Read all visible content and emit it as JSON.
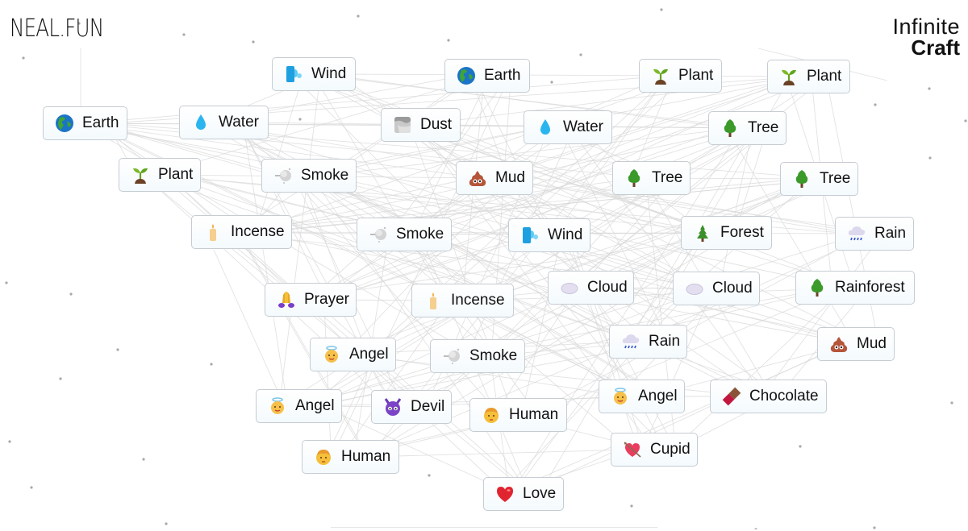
{
  "header": {
    "site_logo": "NEAL.FUN",
    "app_title_line1": "Infinite",
    "app_title_line2": "Craft"
  },
  "items": [
    {
      "label": "Wind",
      "icon": "wind-face-icon"
    },
    {
      "label": "Earth",
      "icon": "globe-icon"
    },
    {
      "label": "Plant",
      "icon": "seedling-icon"
    },
    {
      "label": "Plant",
      "icon": "seedling-icon"
    },
    {
      "label": "Earth",
      "icon": "globe-icon"
    },
    {
      "label": "Water",
      "icon": "droplet-icon"
    },
    {
      "label": "Dust",
      "icon": "dust-icon"
    },
    {
      "label": "Water",
      "icon": "droplet-icon"
    },
    {
      "label": "Tree",
      "icon": "tree-icon"
    },
    {
      "label": "Plant",
      "icon": "seedling-icon"
    },
    {
      "label": "Smoke",
      "icon": "smoke-icon"
    },
    {
      "label": "Mud",
      "icon": "mud-icon"
    },
    {
      "label": "Tree",
      "icon": "tree-icon"
    },
    {
      "label": "Tree",
      "icon": "tree-icon"
    },
    {
      "label": "Incense",
      "icon": "candle-icon"
    },
    {
      "label": "Smoke",
      "icon": "smoke-icon"
    },
    {
      "label": "Wind",
      "icon": "wind-face-icon"
    },
    {
      "label": "Forest",
      "icon": "evergreen-icon"
    },
    {
      "label": "Rain",
      "icon": "rain-cloud-icon"
    },
    {
      "label": "Prayer",
      "icon": "praying-hands-icon"
    },
    {
      "label": "Incense",
      "icon": "candle-icon"
    },
    {
      "label": "Cloud",
      "icon": "cloud-icon"
    },
    {
      "label": "Cloud",
      "icon": "cloud-icon"
    },
    {
      "label": "Rainforest",
      "icon": "tree-icon"
    },
    {
      "label": "Angel",
      "icon": "angel-icon"
    },
    {
      "label": "Smoke",
      "icon": "smoke-icon"
    },
    {
      "label": "Rain",
      "icon": "rain-cloud-icon"
    },
    {
      "label": "Mud",
      "icon": "mud-icon"
    },
    {
      "label": "Angel",
      "icon": "angel-icon"
    },
    {
      "label": "Devil",
      "icon": "devil-icon"
    },
    {
      "label": "Human",
      "icon": "person-icon"
    },
    {
      "label": "Angel",
      "icon": "angel-icon"
    },
    {
      "label": "Chocolate",
      "icon": "chocolate-icon"
    },
    {
      "label": "Human",
      "icon": "person-icon"
    },
    {
      "label": "Cupid",
      "icon": "heart-arrow-icon"
    },
    {
      "label": "Love",
      "icon": "heart-icon"
    }
  ],
  "colors": {
    "item_border": "#c5ccd2",
    "item_bg_bottom": "#f4fafd",
    "line": "#d9d9d9"
  }
}
